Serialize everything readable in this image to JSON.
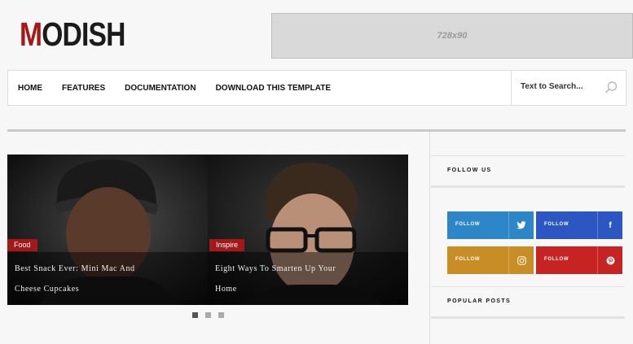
{
  "brand": {
    "logo_first": "M",
    "logo_rest": "ODISH"
  },
  "ad": {
    "label": "728x90"
  },
  "nav": {
    "items": [
      {
        "label": "HOME"
      },
      {
        "label": "FEATURES"
      },
      {
        "label": "DOCUMENTATION"
      },
      {
        "label": "DOWNLOAD THIS TEMPLATE"
      }
    ],
    "search_placeholder": "Text to Search..."
  },
  "slider": {
    "slides": [
      {
        "tag": "Food",
        "title": "Best Snack Ever: Mini Mac And Cheese Cupcakes"
      },
      {
        "tag": "Inspire",
        "title": "Eight Ways To Smarten Up Your Home"
      }
    ],
    "dots": 3,
    "active_dot": 1
  },
  "sidebar": {
    "follow_title": "FOLLOW US",
    "follow_buttons": [
      {
        "label": "FOLLOW",
        "icon": "twitter-icon",
        "glyph": "🐦",
        "color": "#2d86c7"
      },
      {
        "label": "FOLLOW",
        "icon": "facebook-icon",
        "glyph": "f",
        "color": "#2c57c2"
      },
      {
        "label": "FOLLOW",
        "icon": "instagram-icon",
        "glyph": "◎",
        "color": "#c98d26"
      },
      {
        "label": "FOLLOW",
        "icon": "pinterest-icon",
        "glyph": "P",
        "color": "#c82323"
      }
    ],
    "popular_title": "POPULAR POSTS"
  },
  "colors": {
    "accent": "#a31818"
  }
}
